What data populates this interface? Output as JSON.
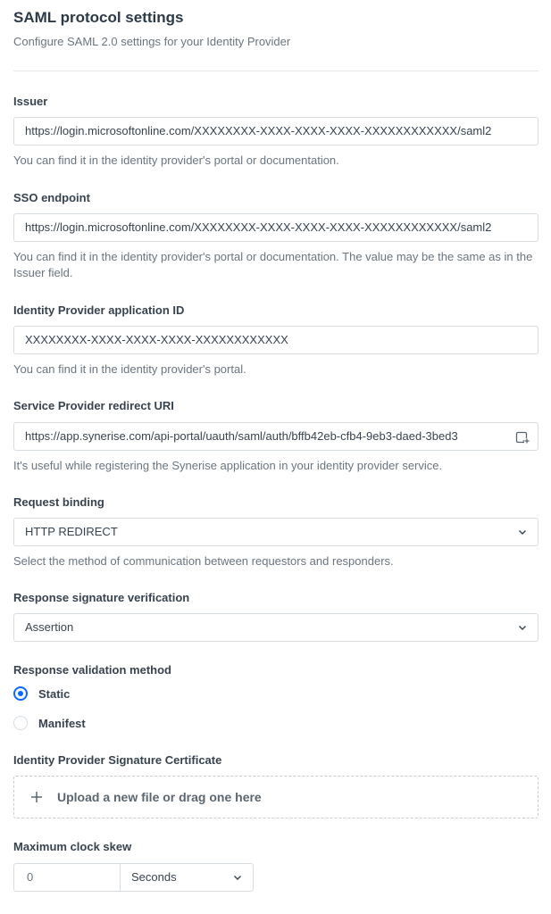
{
  "header": {
    "title": "SAML protocol settings",
    "subtitle": "Configure SAML 2.0 settings for your Identity Provider"
  },
  "issuer": {
    "label": "Issuer",
    "value": "https://login.microsoftonline.com/XXXXXXXX-XXXX-XXXX-XXXX-XXXXXXXXXXXX/saml2",
    "hint": "You can find it in the identity provider's portal or documentation."
  },
  "sso_endpoint": {
    "label": "SSO endpoint",
    "value": "https://login.microsoftonline.com/XXXXXXXX-XXXX-XXXX-XXXX-XXXXXXXXXXXX/saml2",
    "hint": "You can find it in the identity provider's portal or documentation. The value may be the same as in the Issuer field."
  },
  "idp_app_id": {
    "label": "Identity Provider application ID",
    "value": "XXXXXXXX-XXXX-XXXX-XXXX-XXXXXXXXXXXX",
    "hint": "You can find it in the identity provider's portal."
  },
  "redirect_uri": {
    "label": "Service Provider redirect URI",
    "value": "https://app.synerise.com/api-portal/uauth/saml/auth/bffb42eb-cfb4-9eb3-daed-3bed3",
    "hint": "It's useful while registering the Synerise application in your identity provider service.",
    "copy_icon": "copy-icon"
  },
  "request_binding": {
    "label": "Request binding",
    "value": "HTTP REDIRECT",
    "hint": "Select the method of communication between requestors and responders."
  },
  "response_signature": {
    "label": "Response signature verification",
    "value": "Assertion"
  },
  "validation_method": {
    "label": "Response validation method",
    "options": [
      {
        "label": "Static",
        "selected": true
      },
      {
        "label": "Manifest",
        "selected": false
      }
    ]
  },
  "certificate": {
    "label": "Identity Provider Signature Certificate",
    "upload_text": "Upload a new file or drag one here"
  },
  "clock_skew": {
    "label": "Maximum clock skew",
    "value": "0",
    "unit": "Seconds"
  },
  "colors": {
    "accent": "#0b68ff",
    "border": "#d8dde2",
    "text": "#384350",
    "muted": "#6a7580"
  }
}
